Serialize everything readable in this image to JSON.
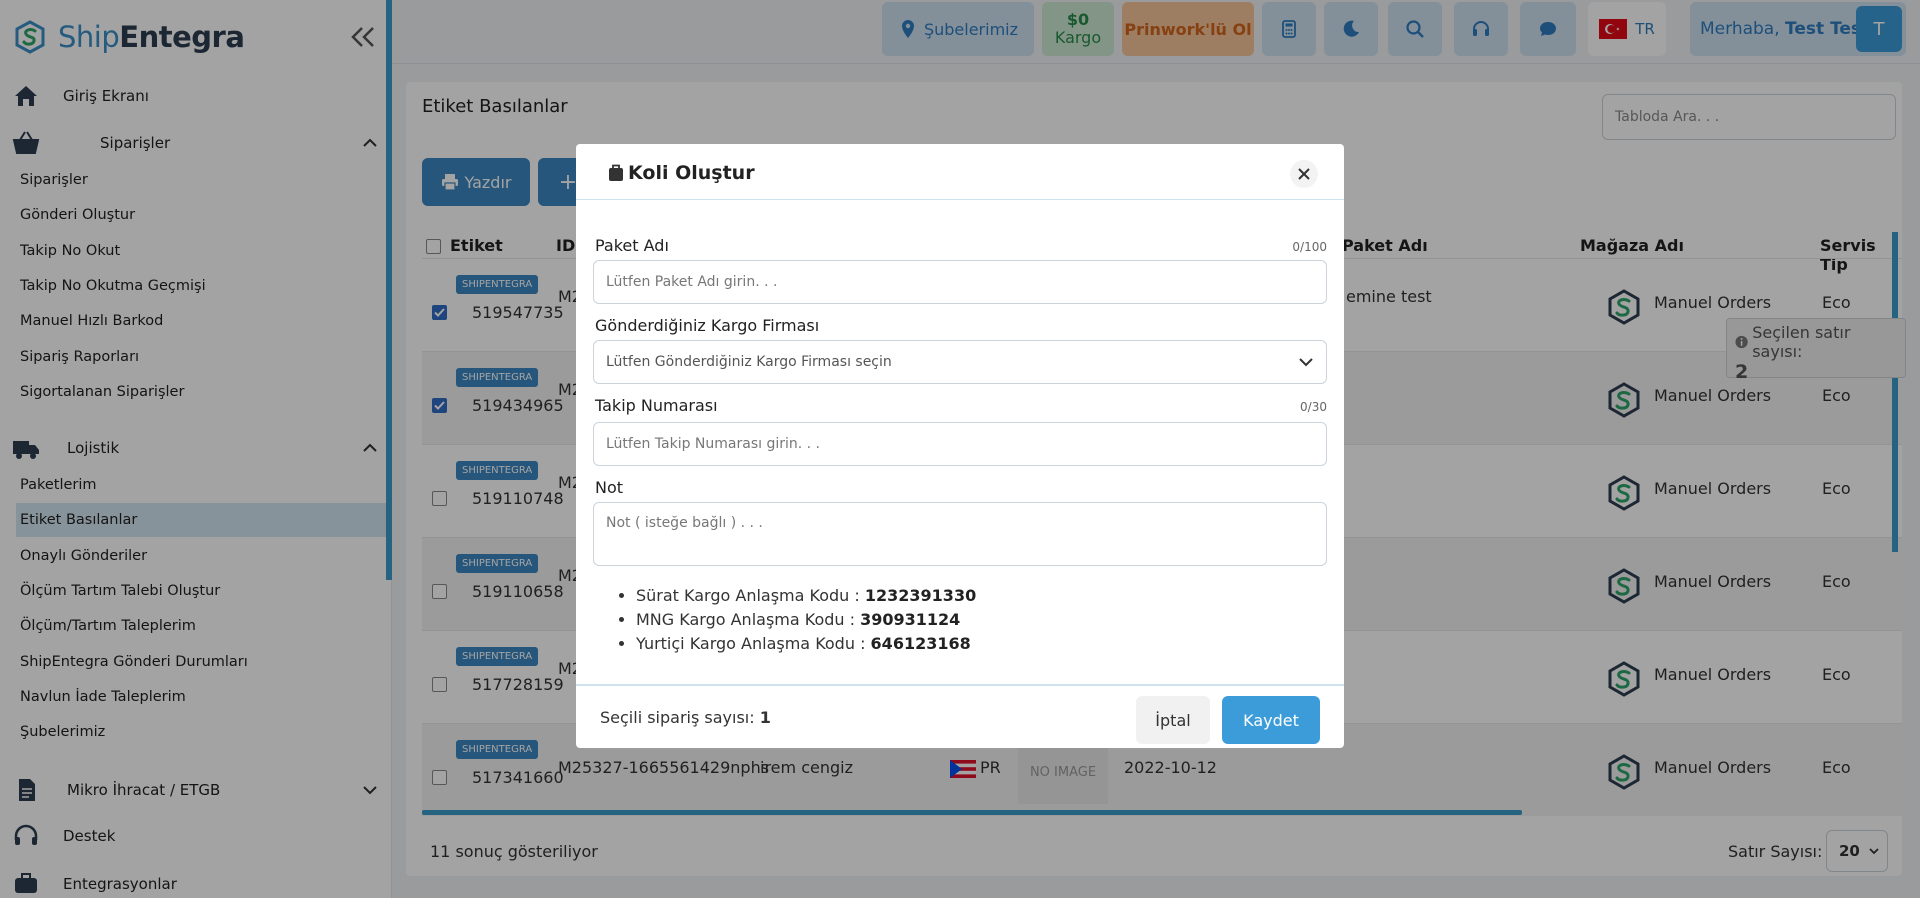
{
  "brand": {
    "name_part1": "Ship",
    "name_part2": "Entegra"
  },
  "sidebar": {
    "home": "Giriş Ekranı",
    "orders_section": "Siparişler",
    "orders_items": [
      "Siparişler",
      "Gönderi Oluştur",
      "Takip No Okut",
      "Takip No Okutma Geçmişi",
      "Manuel Hızlı Barkod",
      "Sipariş Raporları",
      "Sigortalanan Siparişler"
    ],
    "logistics_section": "Lojistik",
    "logistics_items": [
      "Paketlerim",
      "Etiket Basılanlar",
      "Onaylı Gönderiler",
      "Ölçüm Tartım Talebi Oluştur",
      "Ölçüm/Tartım Taleplerim",
      "ShipEntegra Gönderi Durumları",
      "Navlun İade Taleplerim",
      "Şubelerimiz"
    ],
    "export_section": "Mikro İhracat / ETGB",
    "support": "Destek",
    "integrations": "Entegrasyonlar"
  },
  "topbar": {
    "branches": "Şubelerimiz",
    "cargo_amount": "$0",
    "cargo_label": "Kargo",
    "promo": "Prinwork'lü Ol",
    "lang": "TR",
    "greeting": "Merhaba, ",
    "user": "Test Test",
    "avatar": "T"
  },
  "page": {
    "title": "Etiket Basılanlar",
    "search_placeholder": "Tabloda Ara. . .",
    "print_button": "Yazdır",
    "add_button": "+",
    "headers": {
      "label": "Etiket",
      "id": "ID",
      "package": "Paket Adı",
      "store": "Mağaza Adı",
      "service": "Servis Tip"
    },
    "badge": "SHIPENTEGRA",
    "rows": [
      {
        "id": "519547735",
        "order": "M2",
        "package": "emine test",
        "store": "Manuel Orders",
        "service": "Eco"
      },
      {
        "id": "519434965",
        "order": "M2",
        "package": "",
        "store": "Manuel Orders",
        "service": "Eco"
      },
      {
        "id": "519110748",
        "order": "M2",
        "package": "",
        "store": "Manuel Orders",
        "service": "Eco"
      },
      {
        "id": "519110658",
        "order": "M2",
        "package": "",
        "store": "Manuel Orders",
        "service": "Eco"
      },
      {
        "id": "517728159",
        "order": "M2",
        "package": "",
        "store": "Manuel Orders",
        "service": "Eco"
      },
      {
        "id": "517341660",
        "order": "M25327-1665561429nphs",
        "customer": "irem cengiz",
        "country": "PR",
        "noimage": "NO IMAGE",
        "date": "2022-10-12",
        "store": "Manuel Orders",
        "service": "Eco"
      }
    ],
    "results": "11 sonuç gösteriliyor",
    "rows_label": "Satır Sayısı:",
    "rows_value": "20",
    "tooltip_label": "Seçilen satır sayısı:",
    "tooltip_value": "2"
  },
  "modal": {
    "title": "Koli Oluştur",
    "package_label": "Paket Adı",
    "package_count": "0/100",
    "package_placeholder": "Lütfen Paket Adı girin. . .",
    "carrier_label": "Gönderdiğiniz Kargo Firması",
    "carrier_placeholder": "Lütfen Gönderdiğiniz Kargo Firması seçin",
    "tracking_label": "Takip Numarası",
    "tracking_count": "0/30",
    "tracking_placeholder": "Lütfen Takip Numarası girin. . .",
    "note_label": "Not",
    "note_placeholder": "Not ( isteğe bağlı ) . . .",
    "codes": [
      {
        "label": "Sürat Kargo Anlaşma Kodu : ",
        "value": "1232391330"
      },
      {
        "label": "MNG Kargo Anlaşma Kodu : ",
        "value": "390931124"
      },
      {
        "label": "Yurtiçi Kargo Anlaşma Kodu : ",
        "value": "646123168"
      }
    ],
    "selected_label": "Seçili sipariş sayısı: ",
    "selected_value": "1",
    "cancel": "İptal",
    "save": "Kaydet"
  }
}
